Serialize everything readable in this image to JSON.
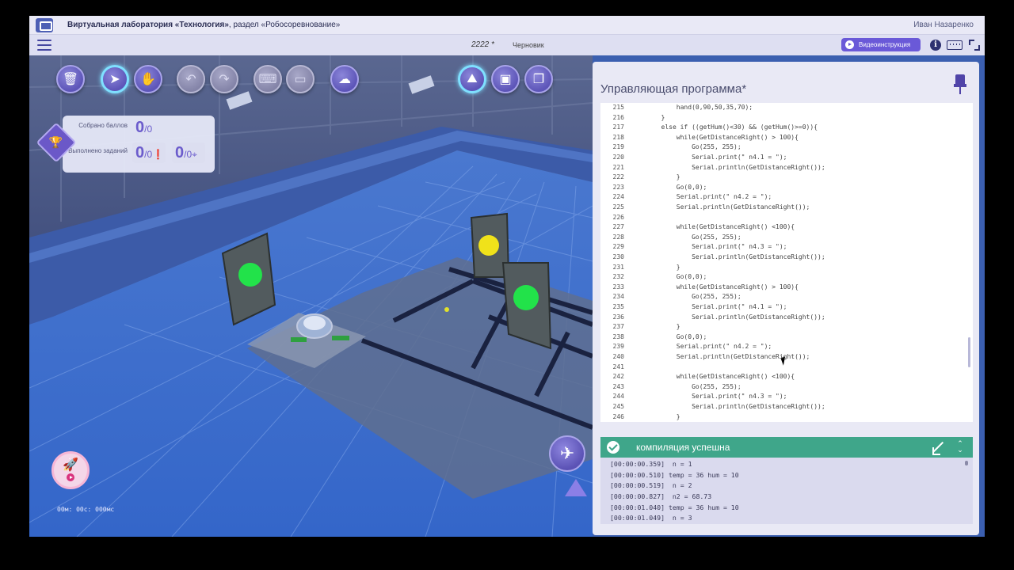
{
  "window": {
    "title_prefix": "Виртуальная лаборатория «Технология»",
    "title_suffix": ", раздел «Робосоревнование»",
    "user": "Иван Назаренко"
  },
  "subbar": {
    "project_name": "2222 *",
    "status": "Черновик",
    "video_button": "Видеоинструкция"
  },
  "toolbar": {
    "buttons": [
      {
        "name": "trash-icon",
        "glyph": "🗑"
      },
      {
        "name": "pointer-icon",
        "glyph": "➤"
      },
      {
        "name": "hand-icon",
        "glyph": "✋"
      },
      {
        "name": "undo-icon",
        "glyph": "↶"
      },
      {
        "name": "redo-icon",
        "glyph": "↷"
      },
      {
        "name": "gamepad-icon",
        "glyph": "⌨"
      },
      {
        "name": "keyboard-icon",
        "glyph": "▭"
      },
      {
        "name": "cloud-upload-icon",
        "glyph": "☁"
      },
      {
        "name": "terrain-view-icon",
        "glyph": "⛰"
      },
      {
        "name": "frame-view-icon",
        "glyph": "▣"
      },
      {
        "name": "layers-icon",
        "glyph": "❐"
      }
    ]
  },
  "score": {
    "points_label": "Собрано баллов",
    "points_value": "0",
    "points_total": "0",
    "tasks_label": "Выполнено заданий",
    "tasks_value": "0",
    "tasks_total": "0",
    "mini1_value": "0",
    "mini1_total": "0",
    "mini2_value": "0",
    "mini2_total": "0"
  },
  "timer": "00м: 00с: 000мс",
  "panel": {
    "title": "Управляющая программа*"
  },
  "code": [
    {
      "n": "215",
      "t": "            hand(0,90,50,35,70);"
    },
    {
      "n": "216",
      "t": "        }"
    },
    {
      "n": "217",
      "t": "        else if ((getHum()<30) && (getHum()>=0)){"
    },
    {
      "n": "218",
      "t": "            while(GetDistanceRight() > 100){"
    },
    {
      "n": "219",
      "t": "                Go(255, 255);"
    },
    {
      "n": "220",
      "t": "                Serial.print(\" n4.1 = \");"
    },
    {
      "n": "221",
      "t": "                Serial.println(GetDistanceRight());"
    },
    {
      "n": "222",
      "t": "            }"
    },
    {
      "n": "223",
      "t": "            Go(0,0);"
    },
    {
      "n": "224",
      "t": "            Serial.print(\" n4.2 = \");"
    },
    {
      "n": "225",
      "t": "            Serial.println(GetDistanceRight());"
    },
    {
      "n": "226",
      "t": ""
    },
    {
      "n": "227",
      "t": "            while(GetDistanceRight() <100){"
    },
    {
      "n": "228",
      "t": "                Go(255, 255);"
    },
    {
      "n": "229",
      "t": "                Serial.print(\" n4.3 = \");"
    },
    {
      "n": "230",
      "t": "                Serial.println(GetDistanceRight());"
    },
    {
      "n": "231",
      "t": "            }"
    },
    {
      "n": "232",
      "t": "            Go(0,0);"
    },
    {
      "n": "233",
      "t": "            while(GetDistanceRight() > 100){"
    },
    {
      "n": "234",
      "t": "                Go(255, 255);"
    },
    {
      "n": "235",
      "t": "                Serial.print(\" n4.1 = \");"
    },
    {
      "n": "236",
      "t": "                Serial.println(GetDistanceRight());"
    },
    {
      "n": "237",
      "t": "            }"
    },
    {
      "n": "238",
      "t": "            Go(0,0);"
    },
    {
      "n": "239",
      "t": "            Serial.print(\" n4.2 = \");"
    },
    {
      "n": "240",
      "t": "            Serial.println(GetDistanceRight());"
    },
    {
      "n": "241",
      "t": ""
    },
    {
      "n": "242",
      "t": "            while(GetDistanceRight() <100){"
    },
    {
      "n": "243",
      "t": "                Go(255, 255);"
    },
    {
      "n": "244",
      "t": "                Serial.print(\" n4.3 = \");"
    },
    {
      "n": "245",
      "t": "                Serial.println(GetDistanceRight());"
    },
    {
      "n": "246",
      "t": "            }"
    }
  ],
  "compile": {
    "status": "компиляция успешна"
  },
  "console": [
    "[00:00:00.359]  n = 1",
    "[00:00:00.510] temp = 36 hum = 10",
    "[00:00:00.519]  n = 2",
    "[00:00:00.827]  n2 = 68.73",
    "[00:00:01.040] temp = 36 hum = 10",
    "[00:00:01.049]  n = 3"
  ],
  "colors": {
    "accent": "#6a59d8",
    "success": "#3fa68a",
    "signal_green": "#22e24a",
    "signal_yellow": "#f0e21a"
  }
}
